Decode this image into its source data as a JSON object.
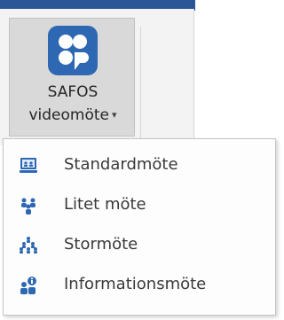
{
  "ribbon": {
    "button": {
      "label_line1": "SAFOS",
      "label_line2": "videomöte",
      "caret": "▾",
      "icon": "safos-logo-icon",
      "icon_color": "#2e68b3"
    }
  },
  "menu": {
    "items": [
      {
        "label": "Standardmöte",
        "icon": "computer-meeting-icon"
      },
      {
        "label": "Litet möte",
        "icon": "small-group-icon"
      },
      {
        "label": "Stormöte",
        "icon": "large-group-icon"
      },
      {
        "label": "Informationsmöte",
        "icon": "info-meeting-icon"
      }
    ]
  },
  "colors": {
    "accent": "#2b5797",
    "icon_blue": "#2e68b3",
    "ribbon_pressed": "#d9d9d9"
  }
}
